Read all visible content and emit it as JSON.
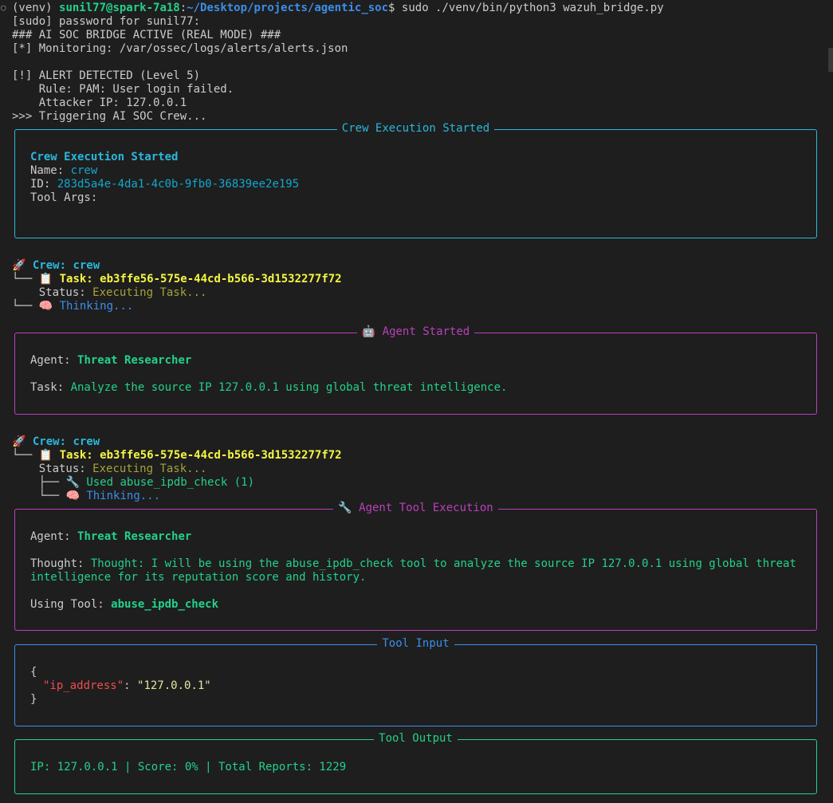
{
  "prompt": {
    "venv": "(venv) ",
    "user_host": "sunil77@spark-7a18",
    "colon": ":",
    "path": "~/Desktop/projects/agentic_soc",
    "dollar": "$ ",
    "command": "sudo ./venv/bin/python3 wazuh_bridge.py"
  },
  "lines": {
    "sudo": "[sudo] password for sunil77:",
    "banner": "### AI SOC BRIDGE ACTIVE (REAL MODE) ###",
    "monitoring": "[*] Monitoring: /var/ossec/logs/alerts/alerts.json",
    "alert": "[!] ALERT DETECTED (Level 5)",
    "rule": "    Rule: PAM: User login failed.",
    "attacker": "    Attacker IP: 127.0.0.1",
    "trigger": ">>> Triggering AI SOC Crew..."
  },
  "panel1": {
    "title": "Crew Execution Started",
    "heading": "Crew Execution Started",
    "name_label": "Name: ",
    "name_value": "crew",
    "id_label": "ID: ",
    "id_value": "283d5a4e-4da1-4c0b-9fb0-36839ee2e195",
    "args_label": "Tool Args:"
  },
  "tree1": {
    "crew_icon": "🚀",
    "crew_label": "Crew: crew",
    "branch1": "└── ",
    "task_icon": "📋",
    "task_label": "Task: eb3ffe56-575e-44cd-b566-3d1532277f72",
    "status_label": "    Status: ",
    "status_value": "Executing Task...",
    "branch2": "└── ",
    "think_icon": "🧠",
    "think_label": "Thinking..."
  },
  "panel2": {
    "title": "🤖 Agent Started",
    "agent_label": "Agent: ",
    "agent_value": "Threat Researcher",
    "task_label": "Task: ",
    "task_value": "Analyze the source IP 127.0.0.1 using global threat intelligence."
  },
  "tree2": {
    "crew_icon": "🚀",
    "crew_label": "Crew: crew",
    "branch1": "└── ",
    "task_icon": "📋",
    "task_label": "Task: eb3ffe56-575e-44cd-b566-3d1532277f72",
    "status_label": "    Status: ",
    "status_value": "Executing Task...",
    "branch_a": "    ├── ",
    "tool_icon": "🔧",
    "tool_label": "Used abuse_ipdb_check (1)",
    "branch_b": "    └── ",
    "think_icon": "🧠",
    "think_label": "Thinking..."
  },
  "panel3": {
    "title": "🔧 Agent Tool Execution",
    "agent_label": "Agent: ",
    "agent_value": "Threat Researcher",
    "thought_label": "Thought: ",
    "thought_line1": "Thought: I will be using the abuse_ipdb_check tool to analyze the source IP 127.0.0.1 using global threat",
    "thought_line2": "intelligence for its reputation score and history.",
    "tool_label": "Using Tool: ",
    "tool_value": "abuse_ipdb_check"
  },
  "panel4": {
    "title": "Tool Input",
    "open": "{",
    "key": "\"ip_address\"",
    "colon": ": ",
    "value": "\"127.0.0.1\"",
    "close": "}"
  },
  "panel5": {
    "title": "Tool Output",
    "output": "IP: 127.0.0.1 | Score: 0% | Total Reports: 1229"
  },
  "colors": {
    "background": "#1e1e1e",
    "panel1_border": "#29b8db",
    "panel2_border": "#bc3fbc",
    "panel3_border": "#bc3fbc",
    "panel4_border": "#3b8eea",
    "panel5_border": "#23d18b"
  }
}
